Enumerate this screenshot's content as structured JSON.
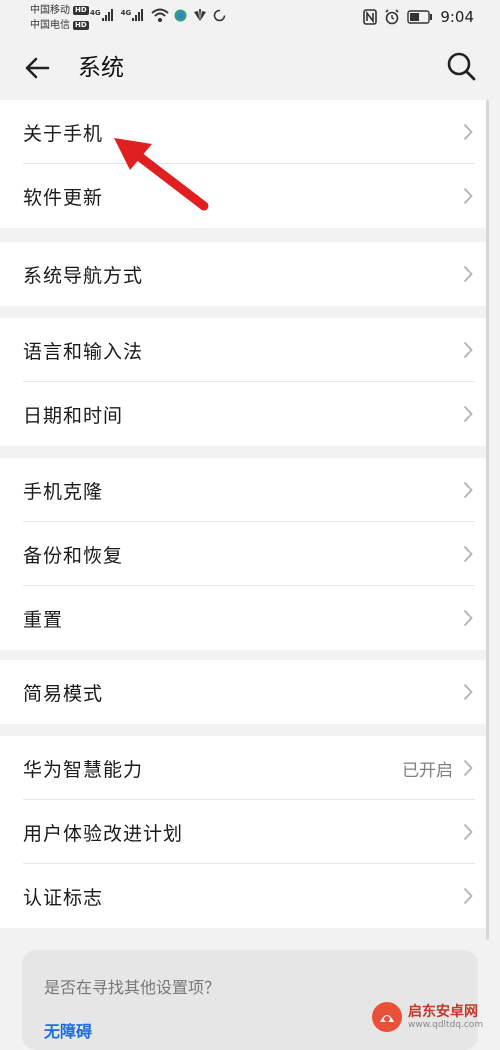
{
  "status_bar": {
    "carrier1": "中国移动",
    "carrier2": "中国电信",
    "hd_badge": "HD",
    "net1": "4G",
    "net2": "4G",
    "time": "9:04"
  },
  "header": {
    "title": "系统",
    "back_icon": "back-arrow-icon",
    "search_icon": "search-icon"
  },
  "groups": [
    {
      "items": [
        {
          "label": "关于手机"
        },
        {
          "label": "软件更新"
        }
      ]
    },
    {
      "items": [
        {
          "label": "系统导航方式"
        }
      ]
    },
    {
      "items": [
        {
          "label": "语言和输入法"
        },
        {
          "label": "日期和时间"
        }
      ]
    },
    {
      "items": [
        {
          "label": "手机克隆"
        },
        {
          "label": "备份和恢复"
        },
        {
          "label": "重置"
        }
      ]
    },
    {
      "items": [
        {
          "label": "简易模式"
        }
      ]
    },
    {
      "items": [
        {
          "label": "华为智慧能力",
          "value": "已开启"
        },
        {
          "label": "用户体验改进计划"
        },
        {
          "label": "认证标志"
        }
      ]
    }
  ],
  "suggestion": {
    "question": "是否在寻找其他设置项？",
    "link": "无障碍"
  },
  "watermark": {
    "name": "启东安卓网",
    "url": "www.qdltdq.com"
  },
  "colors": {
    "background": "#f2f2f2",
    "link": "#1f6fd6",
    "annotation_arrow": "#e02020"
  }
}
